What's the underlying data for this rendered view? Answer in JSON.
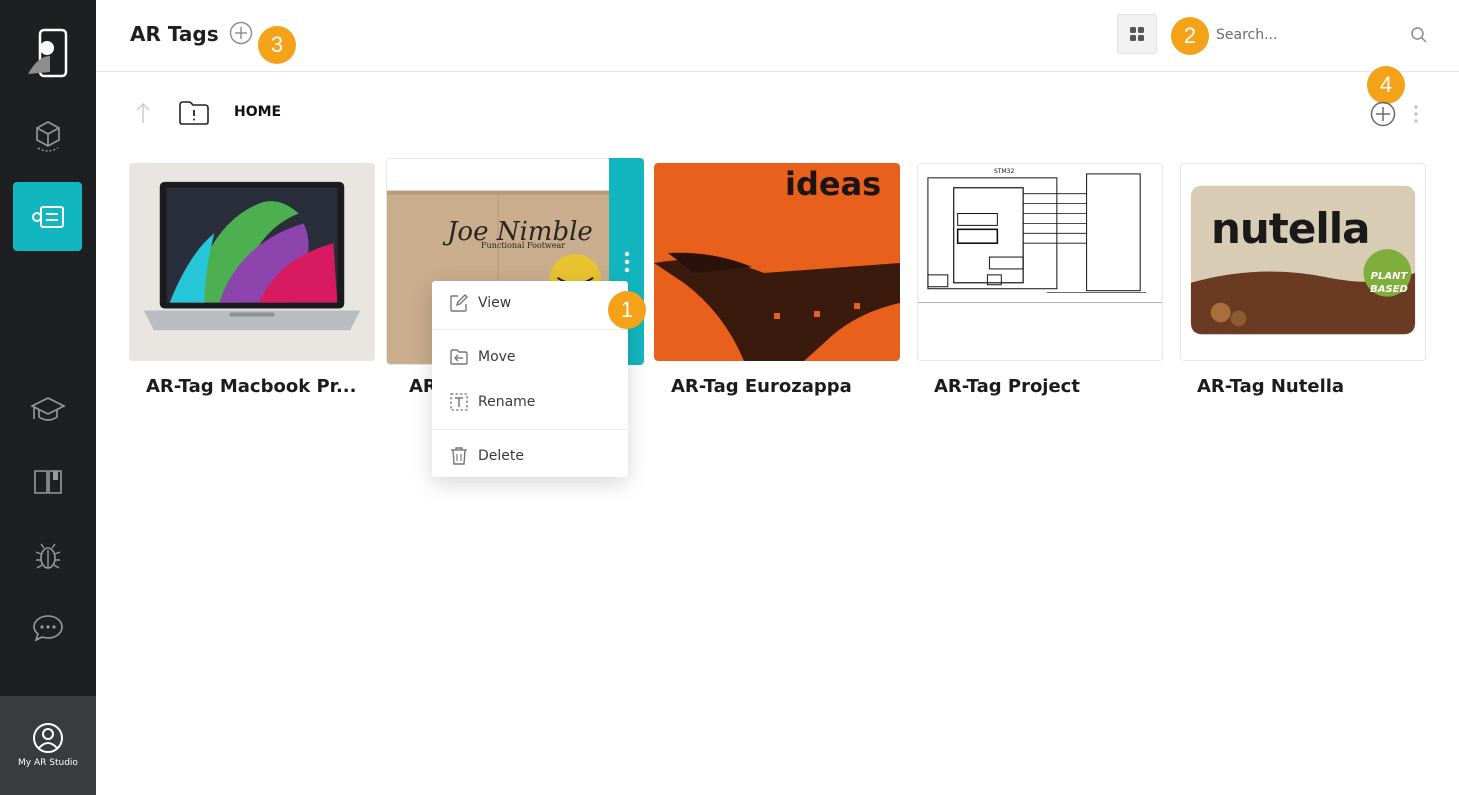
{
  "app": {
    "profile_label": "My AR Studio"
  },
  "sidebar": {
    "items": [
      {
        "icon": "phone-logo-icon"
      },
      {
        "icon": "ar-cube-icon"
      },
      {
        "icon": "ar-tag-icon",
        "active": true
      },
      {
        "icon": "graduation-cap-icon"
      },
      {
        "icon": "book-icon"
      },
      {
        "icon": "bug-icon"
      },
      {
        "icon": "chat-bubble-icon"
      }
    ],
    "active_color": "#12b6bf"
  },
  "header": {
    "title": "AR Tags",
    "search_placeholder": "Search..."
  },
  "badges": {
    "b1": "1",
    "b2": "2",
    "b3": "3",
    "b4": "4",
    "color": "#f4a218"
  },
  "toolbar": {
    "breadcrumb": "HOME"
  },
  "cards": [
    {
      "label": "AR-Tag Macbook Pr...",
      "image": "macbook"
    },
    {
      "label": "AR",
      "image": "joe-nimble-box"
    },
    {
      "label": "AR-Tag Eurozappa",
      "image": "ideas-orange"
    },
    {
      "label": "AR-Tag Project",
      "image": "stm32-diagram"
    },
    {
      "label": "AR-Tag Nutella",
      "image": "nutella-jar"
    }
  ],
  "card_images": {
    "joe_brand": "Joe Nimble",
    "joe_sub": "Functional Footwear",
    "ideas_text": "ideas",
    "stm32_title": "STM32",
    "nutella_text": "nutella",
    "nutella_badge_1": "PLANT",
    "nutella_badge_2": "BASED"
  },
  "context_menu": {
    "view": "View",
    "move": "Move",
    "rename": "Rename",
    "delete": "Delete"
  }
}
